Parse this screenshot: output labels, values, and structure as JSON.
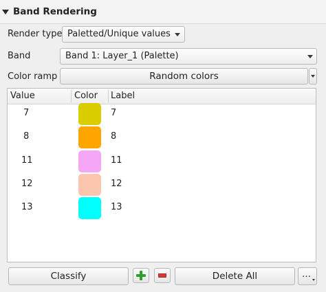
{
  "panel": {
    "title": "Band Rendering"
  },
  "render_type": {
    "label": "Render type",
    "value": "Paletted/Unique values"
  },
  "band": {
    "label": "Band",
    "value": "Band 1: Layer_1 (Palette)"
  },
  "color_ramp": {
    "label": "Color ramp",
    "value": "Random colors"
  },
  "table": {
    "headers": {
      "value": "Value",
      "color": "Color",
      "label": "Label"
    },
    "rows": [
      {
        "value": "7",
        "label": "7",
        "color": "#d9cd00"
      },
      {
        "value": "8",
        "label": "8",
        "color": "#ffa500"
      },
      {
        "value": "11",
        "label": "11",
        "color": "#f6a6f6"
      },
      {
        "value": "12",
        "label": "12",
        "color": "#fcc5ad"
      },
      {
        "value": "13",
        "label": "13",
        "color": "#00ffff"
      }
    ]
  },
  "buttons": {
    "classify": "Classify",
    "delete_all": "Delete All",
    "more": "…",
    "add_icon": "plus-icon",
    "remove_icon": "minus-icon"
  }
}
